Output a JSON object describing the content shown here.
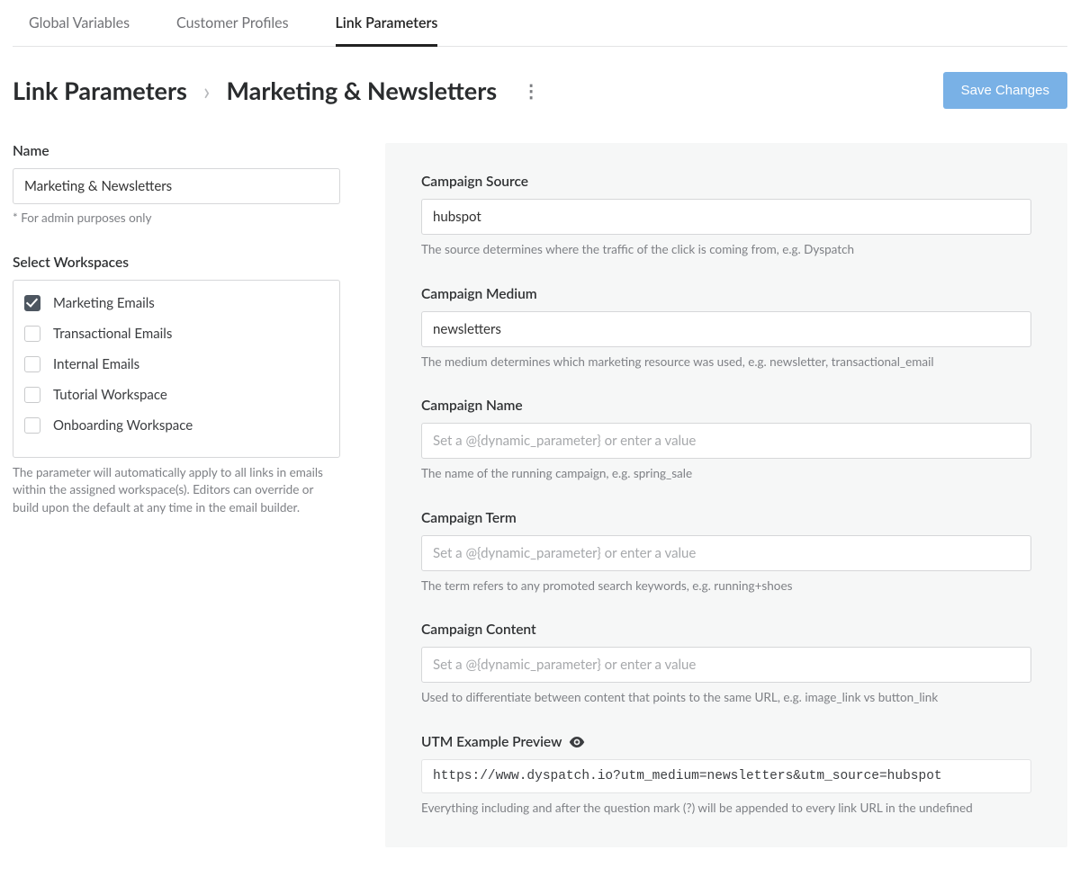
{
  "tabs": [
    {
      "label": "Global Variables",
      "active": false
    },
    {
      "label": "Customer Profiles",
      "active": false
    },
    {
      "label": "Link Parameters",
      "active": true
    }
  ],
  "breadcrumb": {
    "root": "Link Parameters",
    "current": "Marketing & Newsletters"
  },
  "save_button": "Save Changes",
  "left": {
    "name_label": "Name",
    "name_value": "Marketing & Newsletters",
    "name_hint": "* For admin purposes only",
    "ws_label": "Select Workspaces",
    "workspaces": [
      {
        "label": "Marketing Emails",
        "checked": true
      },
      {
        "label": "Transactional Emails",
        "checked": false
      },
      {
        "label": "Internal Emails",
        "checked": false
      },
      {
        "label": "Tutorial Workspace",
        "checked": false
      },
      {
        "label": "Onboarding Workspace",
        "checked": false
      }
    ],
    "ws_hint": "The parameter will automatically apply to all links in emails within the assigned workspace(s). Editors can override or build upon the default at any time in the email builder."
  },
  "right": {
    "dynamic_placeholder": "Set a @{dynamic_parameter} or enter a value",
    "source": {
      "label": "Campaign Source",
      "value": "hubspot",
      "hint": "The source determines where the traffic of the click is coming from, e.g. Dyspatch"
    },
    "medium": {
      "label": "Campaign Medium",
      "value": "newsletters",
      "hint": "The medium determines which marketing resource was used, e.g. newsletter, transactional_email"
    },
    "name": {
      "label": "Campaign Name",
      "value": "",
      "hint": "The name of the running campaign, e.g. spring_sale"
    },
    "term": {
      "label": "Campaign Term",
      "value": "",
      "hint": "The term refers to any promoted search keywords, e.g. running+shoes"
    },
    "content": {
      "label": "Campaign Content",
      "value": "",
      "hint": "Used to differentiate between content that points to the same URL, e.g. image_link vs button_link"
    },
    "preview": {
      "label": "UTM Example Preview",
      "url": "https://www.dyspatch.io?utm_medium=newsletters&utm_source=hubspot",
      "hint": "Everything including and after the question mark (?) will be appended to every link URL in the undefined"
    }
  }
}
